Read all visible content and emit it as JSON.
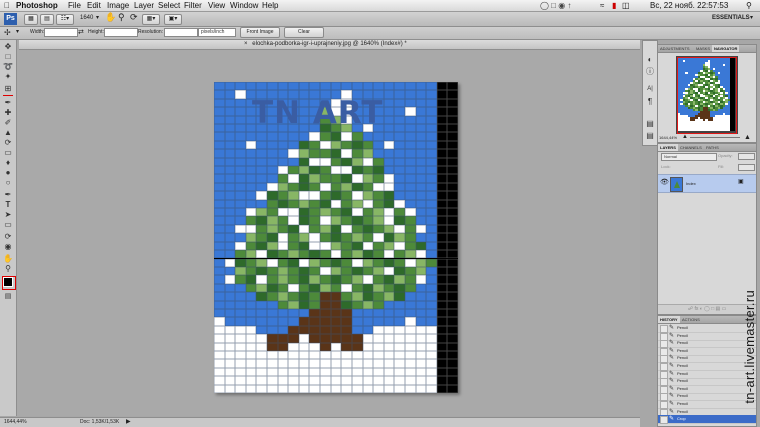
{
  "menubar": {
    "app": "Photoshop",
    "items": [
      "File",
      "Edit",
      "Image",
      "Layer",
      "Select",
      "Filter",
      "View",
      "Window",
      "Help"
    ],
    "clock": "Вс, 22 нояб.  22:57:53"
  },
  "appbar": {
    "zoom": "1640",
    "workspace": "ESSENTIALS"
  },
  "options": {
    "width_label": "Width:",
    "height_label": "Height:",
    "resolution_label": "Resolution:",
    "units": "pixels/inch",
    "front_image": "Front Image",
    "clear": "Clear"
  },
  "document": {
    "tab_title": "elochka-podborka-igr-i-uprajneniy.jpg @ 1640% (Index#) *",
    "watermark_logo": "TN ART"
  },
  "status": {
    "zoom": "1644,44%",
    "doc": "Doc: 1,53K/1,53K"
  },
  "navigator": {
    "tabs": [
      "ADJUSTMENTS",
      "MASKS",
      "NAVIGATOR"
    ],
    "zoom": "1644,44%"
  },
  "layers": {
    "tabs": [
      "LAYERS",
      "CHANNELS",
      "PATHS"
    ],
    "blend": "Normal",
    "opacity_label": "Opacity:",
    "lock_label": "Lock:",
    "fill_label": "Fill:",
    "layer_name": "Index"
  },
  "history": {
    "tabs": [
      "HISTORY",
      "ACTIONS"
    ],
    "items": [
      "Pencil",
      "Pencil",
      "Pencil",
      "Pencil",
      "Pencil",
      "Pencil",
      "Pencil",
      "Pencil",
      "Pencil",
      "Pencil",
      "Pencil",
      "Pencil",
      "Crop"
    ]
  },
  "side_watermark": "tn-art.livemaster.ru",
  "colors": {
    "sky": "#3a78d6",
    "snow": "#ffffff",
    "green_dark": "#2e6a2a",
    "green": "#4d8a3a",
    "green_light": "#88b665",
    "trunk": "#5a3418",
    "grid": "#6f8fb0"
  },
  "pixel_art": {
    "cols": 23,
    "palette": {
      ".": "#3a78d6",
      "W": "#ffffff",
      "D": "#2e6a2a",
      "G": "#4d8a3a",
      "L": "#88b665",
      "B": "#5a3418",
      "K": "#000000"
    },
    "rows": [
      ".....................KK",
      "..W.........W........KK",
      "...........WW........KK",
      "..........LWW.....W..KK",
      "..........GLW........KK",
      "..........DGL.W......KK",
      ".........WGDWG.......KK",
      "...W....DGWLGDG.W....KK",
      ".......WLGGDWGL......KK",
      "........DWWGDLWG.....KK",
      "......WGLDGWWDGD.....KK",
      "......GWDLGGDWLGW....KK",
      ".....WLGDGWGLDGWW....KK",
      "....WDGLWWGDGWLGD....KK",
      ".....GDGLGDWGLWGDW...KK",
      "...WLGWWDGLGDWGLWGW..KK",
      "...GDLGWDGWLGDGLWDG..KK",
      "..WWGLGDWGLDWGDGLWGW.KK",
      "...LGDWGLWGDGLGWDLG..KK",
      "..WGDLWGDWWLGDWGLWGD.KK",
      "..GLWDGLGDGWGLDGWGLW.KK",
      ".WDGLWGDWLGDGWLGDGWLGKK",
      "..LGDGLGDGWLGDGLWDGL.KK",
      ".WGDWGLGDLGDGLWGDLGW.KK",
      "...GLDGWGDLGWGDLGDG..KK",
      "....DGLGDGBBGLDGLD...KK",
      "......GLDGBBDGLG.....KK",
      ".........BBBB........KK",
      "W.......BBBBB.....W..KK",
      "WWWW...BBBBBB..WWWWWWKK",
      "WWWWWBBBWBBBBBWWWWWWWKK",
      "WWWWWBBWWWBWBBWWWWWWWKK",
      "WWWWWWWWWWWWWWWWWWWWWKK",
      "WWWWWWWWWWWWWWWWWWWWWKK",
      "WWWWWWWWWWWWWWWWWWWWWKK",
      "WWWWWWWWWWWWWWWWWWWWWKK",
      "WWWWWWWWWWWWWWWWWWWWWKK"
    ]
  }
}
